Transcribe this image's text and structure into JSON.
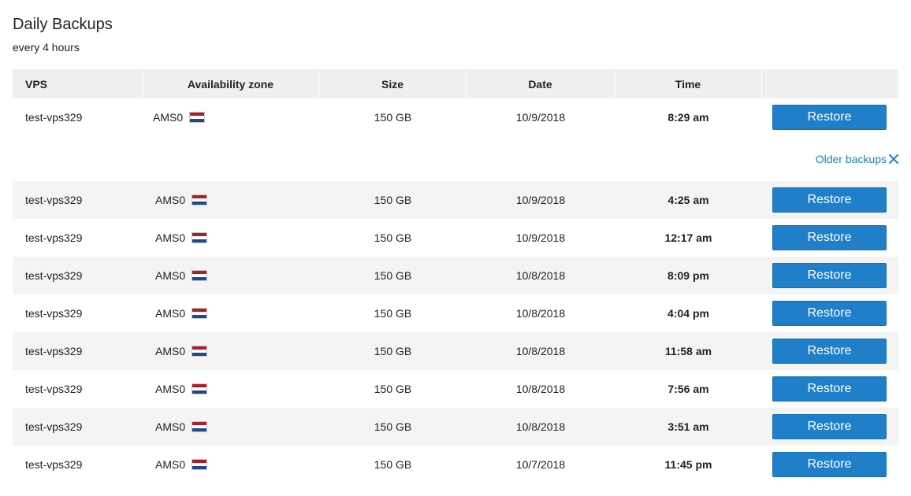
{
  "page": {
    "title": "Daily Backups",
    "subtitle": "every 4 hours"
  },
  "table": {
    "headers": [
      "VPS",
      "Availability zone",
      "Size",
      "Date",
      "Time",
      ""
    ],
    "latest": {
      "vps": "test-vps329",
      "zone": "AMS0",
      "flag_icon": "netherlands-flag-icon",
      "size": "150 GB",
      "date": "10/9/2018",
      "time": "8:29 am",
      "action": "Restore"
    },
    "older_backups_label": "Older backups",
    "older": [
      {
        "vps": "test-vps329",
        "zone": "AMS0",
        "size": "150 GB",
        "date": "10/9/2018",
        "time": "4:25 am",
        "action": "Restore"
      },
      {
        "vps": "test-vps329",
        "zone": "AMS0",
        "size": "150 GB",
        "date": "10/9/2018",
        "time": "12:17 am",
        "action": "Restore"
      },
      {
        "vps": "test-vps329",
        "zone": "AMS0",
        "size": "150 GB",
        "date": "10/8/2018",
        "time": "8:09 pm",
        "action": "Restore"
      },
      {
        "vps": "test-vps329",
        "zone": "AMS0",
        "size": "150 GB",
        "date": "10/8/2018",
        "time": "4:04 pm",
        "action": "Restore"
      },
      {
        "vps": "test-vps329",
        "zone": "AMS0",
        "size": "150 GB",
        "date": "10/8/2018",
        "time": "11:58 am",
        "action": "Restore"
      },
      {
        "vps": "test-vps329",
        "zone": "AMS0",
        "size": "150 GB",
        "date": "10/8/2018",
        "time": "7:56 am",
        "action": "Restore"
      },
      {
        "vps": "test-vps329",
        "zone": "AMS0",
        "size": "150 GB",
        "date": "10/8/2018",
        "time": "3:51 am",
        "action": "Restore"
      },
      {
        "vps": "test-vps329",
        "zone": "AMS0",
        "size": "150 GB",
        "date": "10/7/2018",
        "time": "11:45 pm",
        "action": "Restore"
      }
    ]
  },
  "colors": {
    "accent": "#1f7fc9",
    "header_bg": "#efefef",
    "zebra_bg": "#f4f4f4",
    "flag_red": "#ae1c28",
    "flag_white": "#ffffff",
    "flag_blue": "#21468b"
  }
}
